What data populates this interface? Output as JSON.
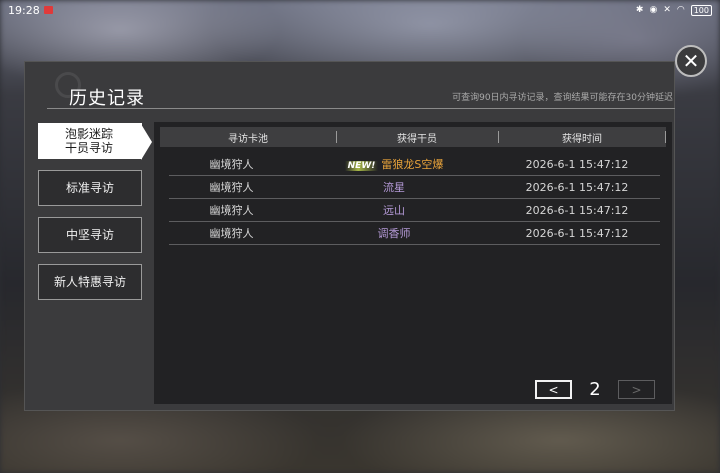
{
  "statusbar": {
    "time": "19:28",
    "battery": "100"
  },
  "panel": {
    "title": "历史记录",
    "note": "可查询90日内寻访记录，查询结果可能存在30分钟延迟"
  },
  "sidebar": {
    "items": [
      {
        "label": "泡影迷踪\n干员寻访",
        "active": true
      },
      {
        "label": "标准寻访",
        "active": false
      },
      {
        "label": "中坚寻访",
        "active": false
      },
      {
        "label": "新人特惠寻访",
        "active": false
      }
    ]
  },
  "table": {
    "headers": [
      "寻访卡池",
      "获得干员",
      "获得时间"
    ],
    "rows": [
      {
        "pool": "幽境狩人",
        "badge": "NEW!",
        "operator": "雷狼龙S空爆",
        "time": "2026-6-1 15:47:12"
      },
      {
        "pool": "幽境狩人",
        "badge": "",
        "operator": "流星",
        "time": "2026-6-1 15:47:12"
      },
      {
        "pool": "幽境狩人",
        "badge": "",
        "operator": "远山",
        "time": "2026-6-1 15:47:12"
      },
      {
        "pool": "幽境狩人",
        "badge": "",
        "operator": "调香师",
        "time": "2026-6-1 15:47:12"
      }
    ]
  },
  "pager": {
    "page": "2",
    "prev": "<",
    "next": ">"
  },
  "close": {
    "label": "✕"
  }
}
